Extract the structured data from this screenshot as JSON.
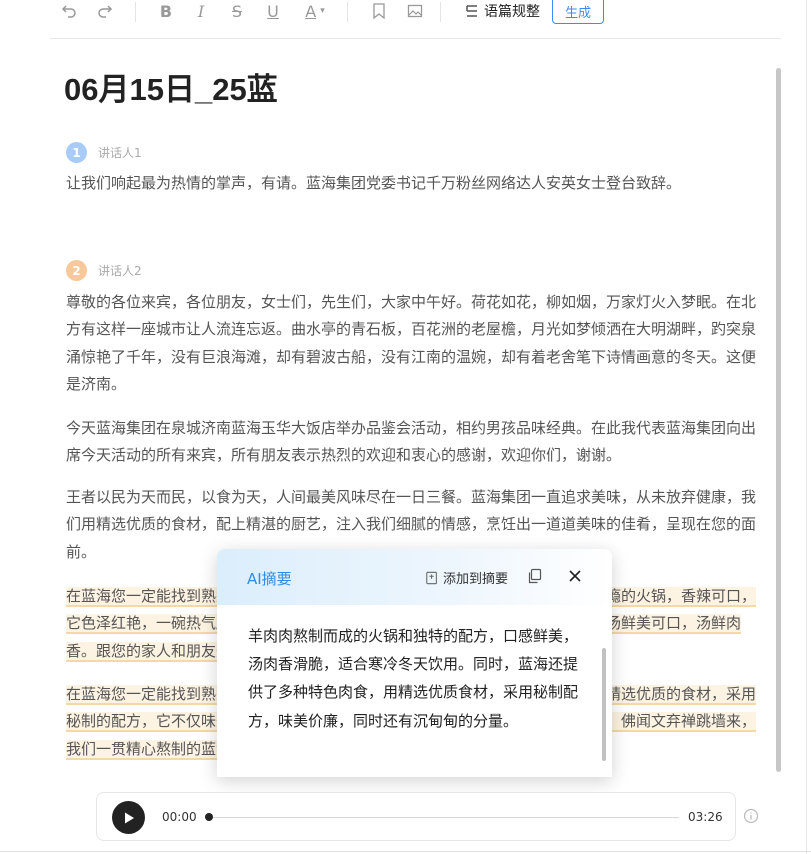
{
  "toolbar": {
    "paragraph_label": "语篇规整",
    "generate_label": "生成"
  },
  "doc": {
    "title": "06月15日_25蓝"
  },
  "speakers": [
    {
      "num": "1",
      "name": "讲话人1",
      "color": "#a8ccf7"
    },
    {
      "num": "2",
      "name": "讲话人2",
      "color": "#f7c89a"
    }
  ],
  "paragraphs": {
    "p1": "让我们响起最为热情的掌声，有请。蓝海集团党委书记千万粉丝网络达人安英女士登台致辞。",
    "p2": "尊敬的各位来宾，各位朋友，女士们，先生们，大家中午好。荷花如花，柳如烟，万家灯火入梦眠。在北方有这样一座城市让人流连忘返。曲水亭的青石板，百花洲的老屋檐，月光如梦倾洒在大明湖畔，趵突泉涌惊艳了千年，没有巨浪海滩，却有碧波古船，没有江南的温婉，却有着老舍笔下诗情画意的冬天。这便是济南。",
    "p3": "今天蓝海集团在泉城济南蓝海玉华大饭店举办品鉴会活动，相约男孩品味经典。在此我代表蓝海集团向出席今天活动的所有来宾，所有朋友表示热烈的欢迎和衷心的感谢，欢迎你们，谢谢。",
    "p4": "王者以民为天而民，以食为天，人间最美风味尽在一日三餐。蓝海集团一直追求美味，从未放弃健康，我们用精选优质的食材，配上精湛的厨艺，注入我们细腻的情感，烹饪出一道道美味的佳肴，呈现在您的面前。",
    "p5": "在蓝海您一定能找到熟悉的味道，这里有正宗的鲁菜，有地道的川味，还有香辣过瘾的火锅，香辣可口，它色泽红艳，一碗热气腾腾的砂锅炖出了生活的滋味，羊肉肉质鲜美细嫩，骨头浓汤鲜美可口，汤鲜肉香。跟您的家人和朋友美美的喝上一碗。",
    "p6": "在蓝海您一定能找到熟悉的味道，蓝海的特色羊肉汤选用优质的羊肉，精心熬制，精选优质的食材，采用秘制的配方，它不仅味美价廉，而且让您回味无穷，正如那句诗，坛启荤香飘四邻，佛闻文弃禅跳墙来，我们一贯精心熬制的蓝海传统佳肴。"
  },
  "ai_summary": {
    "title": "AI摘要",
    "add_label": "添加到摘要",
    "body": "羊肉肉熬制而成的火锅和独特的配方，口感鲜美，汤肉香滑脆，适合寒冷冬天饮用。同时，蓝海还提供了多种特色肉食，用精选优质食材，采用秘制配方，味美价廉，同时还有沉甸甸的分量。"
  },
  "player": {
    "current": "00:00",
    "total": "03:26",
    "progress": 0
  },
  "colors": {
    "accent": "#3b8ef0",
    "highlight": "#fdf3e2"
  }
}
